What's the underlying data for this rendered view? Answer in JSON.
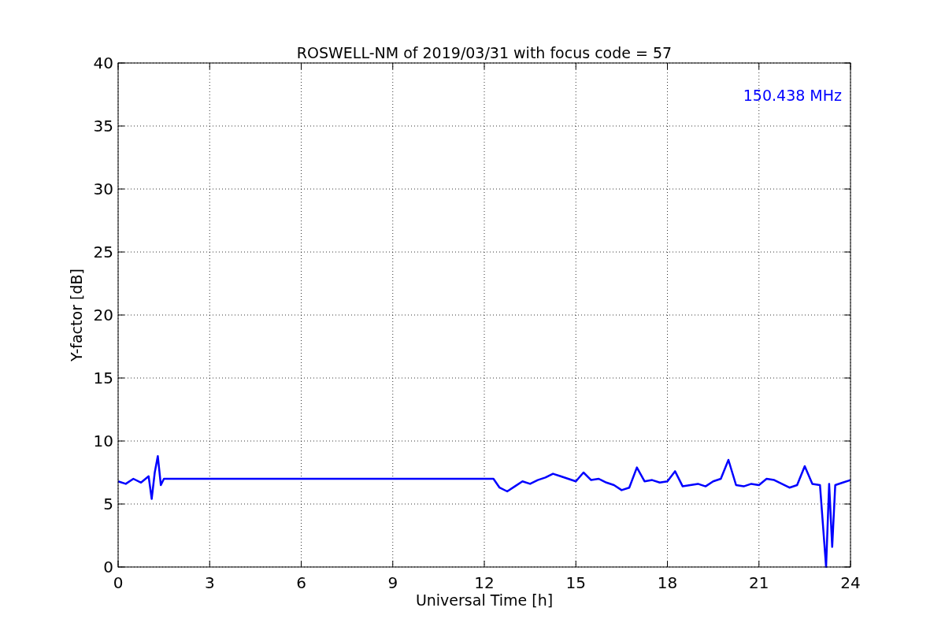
{
  "chart_data": {
    "type": "line",
    "title": "ROSWELL-NM of 2019/03/31 with focus code = 57",
    "xlabel": "Universal Time [h]",
    "ylabel": "Y-factor [dB]",
    "x": [
      0,
      0.25,
      0.5,
      0.75,
      1.0,
      1.1,
      1.2,
      1.3,
      1.4,
      1.5,
      12.3,
      12.5,
      12.75,
      13,
      13.25,
      13.5,
      13.75,
      14,
      14.25,
      14.5,
      14.75,
      15,
      15.25,
      15.5,
      15.75,
      16,
      16.25,
      16.5,
      16.75,
      17,
      17.25,
      17.5,
      17.75,
      18,
      18.25,
      18.5,
      18.75,
      19,
      19.25,
      19.5,
      19.75,
      20,
      20.25,
      20.5,
      20.75,
      21,
      21.25,
      21.5,
      21.75,
      22,
      22.25,
      22.5,
      22.75,
      23,
      23.2,
      23.3,
      23.4,
      23.5,
      23.75,
      24
    ],
    "series": [
      {
        "color": "#0000ff",
        "values": [
          6.8,
          6.6,
          7.0,
          6.7,
          7.2,
          5.4,
          7.5,
          8.8,
          6.5,
          7.0,
          7.0,
          6.3,
          6.0,
          6.4,
          6.8,
          6.6,
          6.9,
          7.1,
          7.4,
          7.2,
          7.0,
          6.8,
          7.5,
          6.9,
          7.0,
          6.7,
          6.5,
          6.1,
          6.3,
          7.9,
          6.8,
          6.9,
          6.7,
          6.8,
          7.6,
          6.4,
          6.5,
          6.6,
          6.4,
          6.8,
          7.0,
          8.5,
          6.5,
          6.4,
          6.6,
          6.5,
          7.0,
          6.9,
          6.6,
          6.3,
          6.5,
          8.0,
          6.6,
          6.5,
          0,
          6.6,
          1.6,
          6.5,
          6.7,
          6.9
        ]
      }
    ],
    "xlim": [
      0,
      24
    ],
    "ylim": [
      0,
      40
    ],
    "xticks": [
      0,
      3,
      6,
      9,
      12,
      15,
      18,
      21,
      24
    ],
    "yticks": [
      0,
      5,
      10,
      15,
      20,
      25,
      30,
      35,
      40
    ],
    "grid": true,
    "annotations": [
      {
        "text": "150.438 MHz"
      }
    ]
  }
}
